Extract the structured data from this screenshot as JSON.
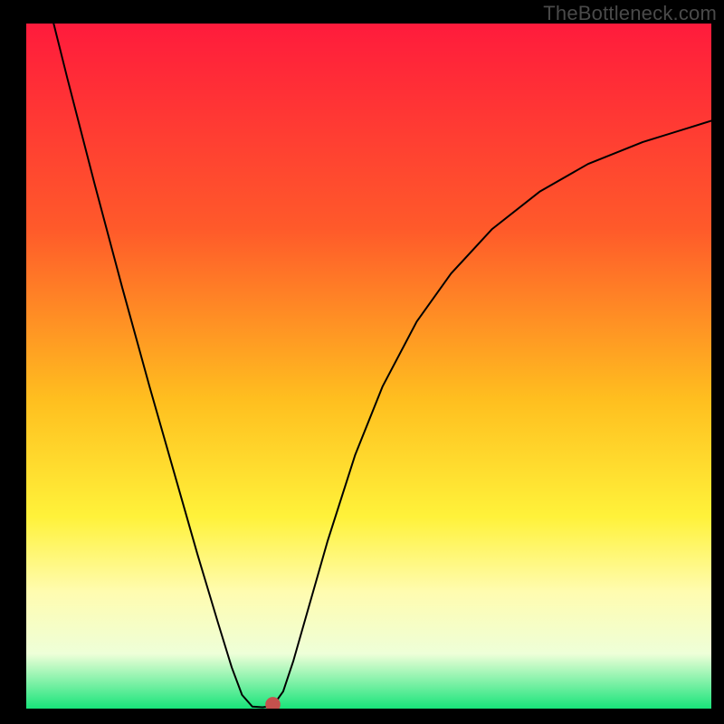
{
  "watermark": "TheBottleneck.com",
  "chart_data": {
    "type": "line",
    "title": "",
    "xlabel": "",
    "ylabel": "",
    "xlim": [
      0,
      100
    ],
    "ylim": [
      0,
      100
    ],
    "gradient_stops": [
      {
        "offset": 0,
        "color": "#ff1b3c"
      },
      {
        "offset": 30,
        "color": "#ff5a2a"
      },
      {
        "offset": 55,
        "color": "#ffbf1f"
      },
      {
        "offset": 72,
        "color": "#fff23a"
      },
      {
        "offset": 83,
        "color": "#fffcb0"
      },
      {
        "offset": 92,
        "color": "#eeffd8"
      },
      {
        "offset": 100,
        "color": "#18e47a"
      }
    ],
    "curve": [
      {
        "x": 4.0,
        "y": 100.0
      },
      {
        "x": 6.0,
        "y": 92.0
      },
      {
        "x": 10.0,
        "y": 76.5
      },
      {
        "x": 14.0,
        "y": 61.5
      },
      {
        "x": 18.0,
        "y": 47.0
      },
      {
        "x": 22.0,
        "y": 33.0
      },
      {
        "x": 25.0,
        "y": 22.5
      },
      {
        "x": 28.0,
        "y": 12.5
      },
      {
        "x": 30.0,
        "y": 6.0
      },
      {
        "x": 31.5,
        "y": 2.0
      },
      {
        "x": 33.0,
        "y": 0.3
      },
      {
        "x": 34.5,
        "y": 0.2
      },
      {
        "x": 36.0,
        "y": 0.4
      },
      {
        "x": 37.5,
        "y": 2.5
      },
      {
        "x": 39.0,
        "y": 7.0
      },
      {
        "x": 41.0,
        "y": 14.0
      },
      {
        "x": 44.0,
        "y": 24.5
      },
      {
        "x": 48.0,
        "y": 37.0
      },
      {
        "x": 52.0,
        "y": 47.0
      },
      {
        "x": 57.0,
        "y": 56.5
      },
      {
        "x": 62.0,
        "y": 63.5
      },
      {
        "x": 68.0,
        "y": 70.0
      },
      {
        "x": 75.0,
        "y": 75.5
      },
      {
        "x": 82.0,
        "y": 79.5
      },
      {
        "x": 90.0,
        "y": 82.7
      },
      {
        "x": 100.0,
        "y": 85.8
      }
    ],
    "marker": {
      "x": 36.0,
      "y": 0.6,
      "color": "#c4514d",
      "radius": 1.1
    }
  }
}
